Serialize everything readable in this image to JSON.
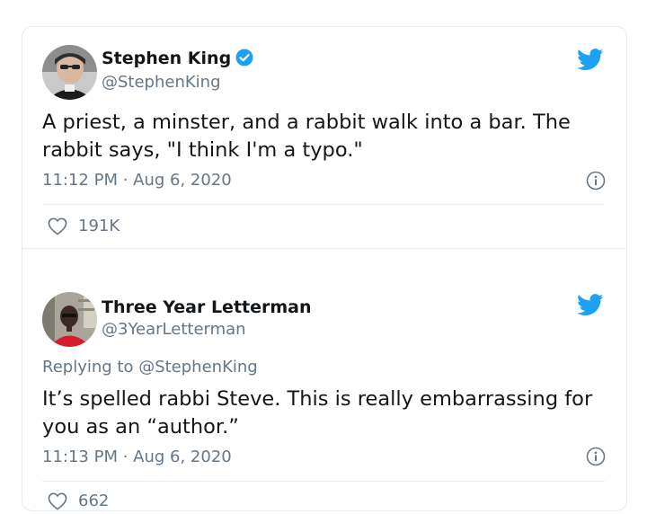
{
  "colors": {
    "text": "#14171a",
    "secondary": "#657786",
    "twitter_blue": "#1da1f2",
    "border": "#e6ecf0"
  },
  "tweets": [
    {
      "author_name": "Stephen King",
      "verified": true,
      "handle": "@StephenKing",
      "text": "A priest, a minster, and a rabbit walk into a bar. The rabbit says, \"I think I'm a typo.\"",
      "timestamp": "11:12 PM · Aug 6, 2020",
      "likes": "191K",
      "icon": "twitter-bird-icon"
    },
    {
      "author_name": "Three Year Letterman",
      "verified": false,
      "handle": "@3YearLetterman",
      "replying_to": "Replying to @StephenKing",
      "text": "It’s spelled rabbi Steve. This is really embarrassing for you as an “author.”",
      "timestamp": "11:13 PM · Aug 6, 2020",
      "likes": "662",
      "icon": "twitter-bird-icon"
    }
  ]
}
